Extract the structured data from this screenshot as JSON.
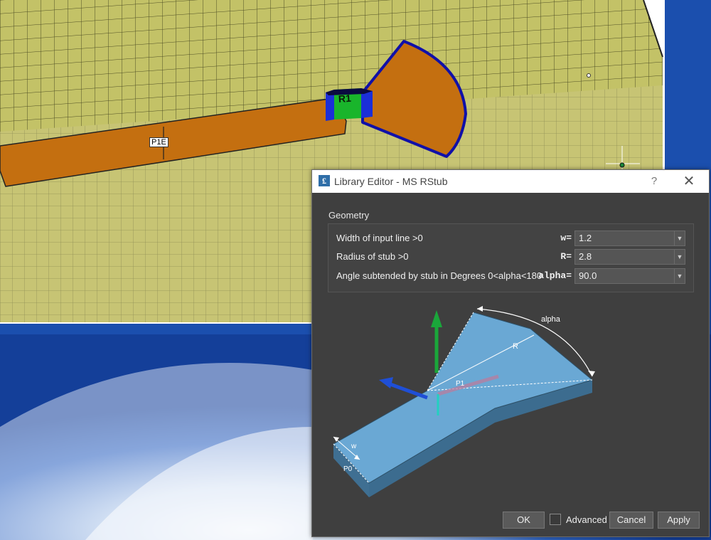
{
  "workspace": {
    "port_label": "P1E",
    "component_label": "R1"
  },
  "dialog": {
    "title": "Library Editor - MS RStub",
    "help_glyph": "?",
    "close_glyph": "✕",
    "section": "Geometry",
    "params": [
      {
        "label": "Width of input line >0",
        "symbol": "w=",
        "value": "1.2"
      },
      {
        "label": "Radius of stub >0",
        "symbol": "R=",
        "value": "2.8"
      },
      {
        "label": "Angle subtended by stub in Degrees 0<alpha<180",
        "symbol": "alpha=",
        "value": "90.0"
      }
    ],
    "diagram_labels": {
      "alpha": "alpha",
      "radius": "R",
      "port1": "P1",
      "width": "w",
      "port0": "P0"
    },
    "buttons": {
      "ok": "OK",
      "advanced": "Advanced",
      "cancel": "Cancel",
      "apply": "Apply"
    }
  }
}
